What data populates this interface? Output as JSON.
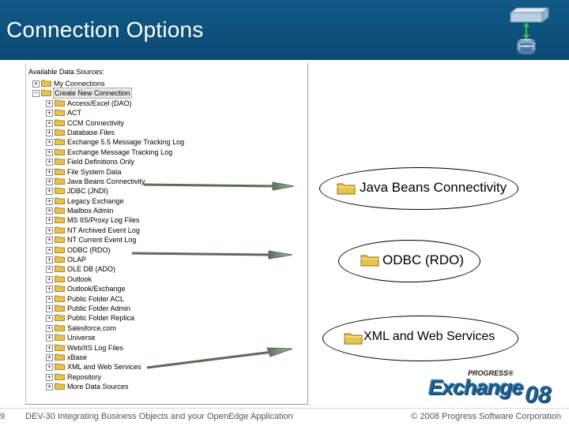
{
  "slide": {
    "title": "Connection Options",
    "page_number": "9",
    "footer_center": "DEV-30 Integrating Business Objects and your OpenEdge Application",
    "footer_right": "© 2008 Progress Software Corporation"
  },
  "panel": {
    "title": "Available Data Sources:",
    "items": [
      {
        "label": "My Connections",
        "expander": "+",
        "level": 0
      },
      {
        "label": "Create New Connection",
        "expander": "−",
        "level": 0,
        "selected": true
      },
      {
        "label": "Access/Excel (DAO)",
        "expander": "+",
        "level": 1
      },
      {
        "label": "ACT",
        "expander": "+",
        "level": 1
      },
      {
        "label": "CCM Connectivity",
        "expander": "+",
        "level": 1
      },
      {
        "label": "Database Files",
        "expander": "+",
        "level": 1
      },
      {
        "label": "Exchange 5.5 Message Tracking Log",
        "expander": "+",
        "level": 1
      },
      {
        "label": "Exchange Message Tracking Log",
        "expander": "+",
        "level": 1
      },
      {
        "label": "Field Definitions Only",
        "expander": "+",
        "level": 1
      },
      {
        "label": "File System Data",
        "expander": "+",
        "level": 1
      },
      {
        "label": "Java Beans Connectivity",
        "expander": "+",
        "level": 1
      },
      {
        "label": "JDBC (JNDI)",
        "expander": "+",
        "level": 1
      },
      {
        "label": "Legacy Exchange",
        "expander": "+",
        "level": 1
      },
      {
        "label": "Mailbox Admin",
        "expander": "+",
        "level": 1
      },
      {
        "label": "MS IIS/Proxy Log Files",
        "expander": "+",
        "level": 1
      },
      {
        "label": "NT Archived Event Log",
        "expander": "+",
        "level": 1
      },
      {
        "label": "NT Current Event Log",
        "expander": "+",
        "level": 1
      },
      {
        "label": "ODBC (RDO)",
        "expander": "+",
        "level": 1
      },
      {
        "label": "OLAP",
        "expander": "+",
        "level": 1
      },
      {
        "label": "OLE DB (ADO)",
        "expander": "+",
        "level": 1
      },
      {
        "label": "Outlook",
        "expander": "+",
        "level": 1
      },
      {
        "label": "Outlook/Exchange",
        "expander": "+",
        "level": 1
      },
      {
        "label": "Public Folder ACL",
        "expander": "+",
        "level": 1
      },
      {
        "label": "Public Folder Admin",
        "expander": "+",
        "level": 1
      },
      {
        "label": "Public Folder Replica",
        "expander": "+",
        "level": 1
      },
      {
        "label": "Salesforce.com",
        "expander": "+",
        "level": 1
      },
      {
        "label": "Universe",
        "expander": "+",
        "level": 1
      },
      {
        "label": "Web/IIS Log Files",
        "expander": "+",
        "level": 1
      },
      {
        "label": "xBase",
        "expander": "+",
        "level": 1
      },
      {
        "label": "XML and Web Services",
        "expander": "+",
        "level": 1
      },
      {
        "label": "Repository",
        "expander": "+",
        "level": 1
      },
      {
        "label": "More Data Sources",
        "expander": "+",
        "level": 1
      }
    ]
  },
  "callouts": {
    "java": "Java Beans Connectivity",
    "odbc": "ODBC (RDO)",
    "xml": "XML and Web Services"
  },
  "logo": {
    "brand": "PROGRESS®",
    "word": "Exchange",
    "year": "08"
  },
  "colors": {
    "header_bg": "#0b4a72",
    "title_text": "#ffffff",
    "folder": "#e8c24a",
    "arrow": "#7f9a7a",
    "logo_blue": "#1f5f8f"
  },
  "icons": {
    "header": "database-sync-icon",
    "folder": "folder-icon"
  }
}
